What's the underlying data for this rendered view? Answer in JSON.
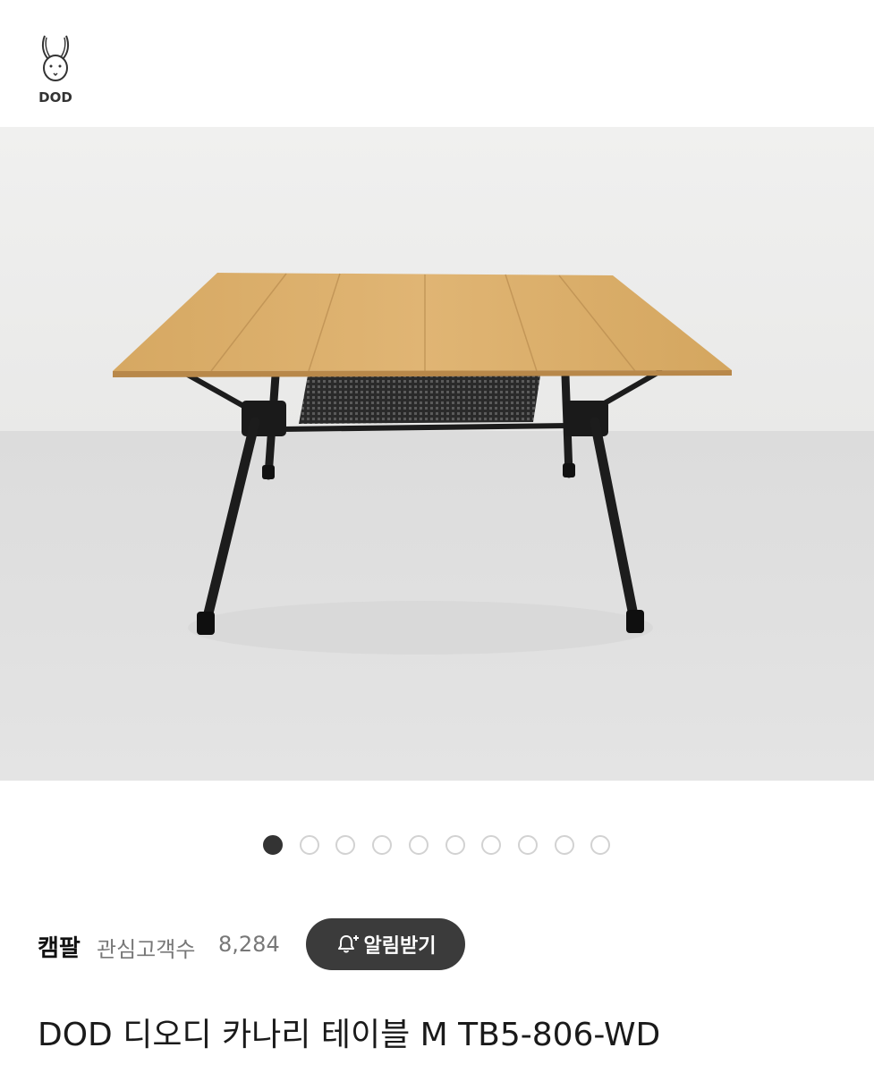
{
  "brand": {
    "logo_text": "DOD",
    "logo_icon": "rabbit-logo-icon"
  },
  "gallery": {
    "slide_count": 10,
    "active_index": 0
  },
  "seller": {
    "name": "캠팔",
    "followers_label": "관심고객수",
    "followers_count": "8,284",
    "alarm_button_label": "알림받기",
    "alarm_icon": "bell-plus-icon"
  },
  "product": {
    "title": "DOD 디오디 카나리 테이블 M TB5-806-WD"
  },
  "colors": {
    "button_bg": "#3b3b3b",
    "dot_active": "#333333",
    "dot_inactive": "#d2d2d2",
    "table_wood": "#d9ad6a"
  }
}
